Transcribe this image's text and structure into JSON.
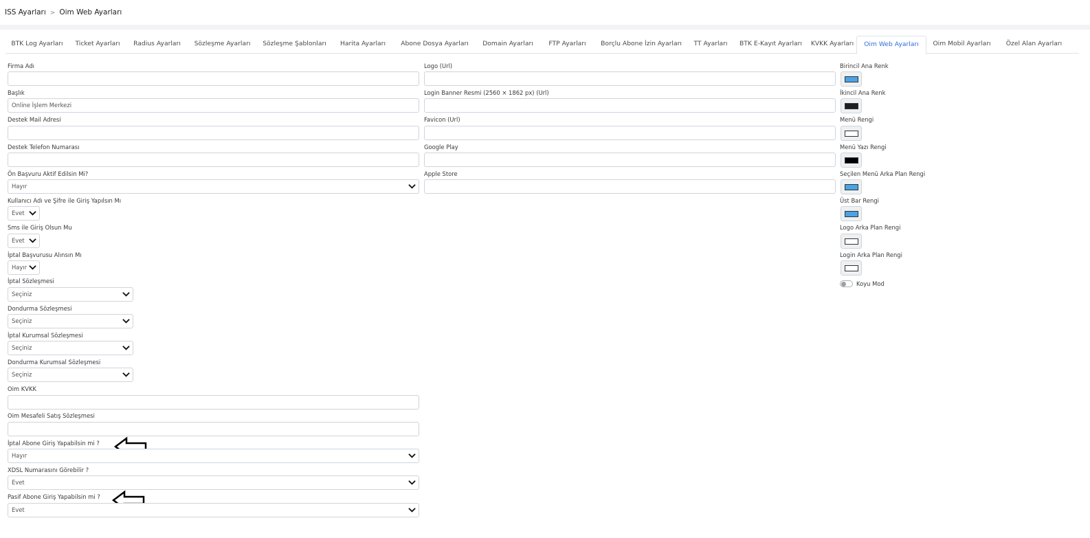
{
  "breadcrumb": {
    "root": "ISS Ayarları",
    "separator": ">",
    "current": "Oim Web Ayarları"
  },
  "tabs": [
    "BTK Log Ayarları",
    "Ticket Ayarları",
    "Radius Ayarları",
    "Sözleşme Ayarları",
    "Sözleşme Şablonları",
    "Harita Ayarları",
    "Abone Dosya Ayarları",
    "Domain Ayarları",
    "FTP Ayarları",
    "Borçlu Abone İzin Ayarları",
    "TT Ayarları",
    "BTK E-Kayıt Ayarları",
    "KVKK Ayarları",
    "Oim Web Ayarları",
    "Oim Mobil Ayarları",
    "Özel Alan Ayarları"
  ],
  "active_tab": "Oim Web Ayarları",
  "left": {
    "firma_adi": {
      "label": "Firma Adı",
      "value": ""
    },
    "baslik": {
      "label": "Başlık",
      "value": "Online İşlem Merkezi"
    },
    "destek_mail": {
      "label": "Destek Mail Adresi",
      "value": ""
    },
    "destek_telefon": {
      "label": "Destek Telefon Numarası",
      "value": ""
    },
    "on_basvuru": {
      "label": "Ön Başvuru Aktif Edilsin Mi?",
      "value": "Hayır"
    },
    "kullanici_sifre": {
      "label": "Kullanıcı Adı ve Şifre ile Giriş Yapılsın Mı",
      "value": "Evet"
    },
    "sms_giris": {
      "label": "Sms ile Giriş Olsun Mu",
      "value": "Evet"
    },
    "iptal_basvurusu": {
      "label": "İptal Başvurusu Alınsın Mı",
      "value": "Hayır"
    },
    "iptal_sozlesmesi": {
      "label": "İptal Sözleşmesi",
      "value": "Seçiniz"
    },
    "dondurma_sozlesmesi": {
      "label": "Dondurma Sözleşmesi",
      "value": "Seçiniz"
    },
    "iptal_kurumsal": {
      "label": "İptal Kurumsal Sözleşmesi",
      "value": "Seçiniz"
    },
    "dondurma_kurumsal": {
      "label": "Dondurma Kurumsal Sözleşmesi",
      "value": "Seçiniz"
    },
    "oim_kvkk": {
      "label": "Oim KVKK",
      "value": ""
    },
    "oim_mesafeli": {
      "label": "Oim Mesafeli Satış Sözleşmesi",
      "value": ""
    },
    "iptal_abone_giris": {
      "label": "İptal Abone Giriş Yapabilsin mi ?",
      "value": "Hayır"
    },
    "xdsl": {
      "label": "XDSL Numarasını Görebilir ?",
      "value": "Evet"
    },
    "pasif_abone_giris": {
      "label": "Pasif Abone Giriş Yapabilsin mi ?",
      "value": "Evet"
    }
  },
  "middle": {
    "logo": {
      "label": "Logo (Url)",
      "value": ""
    },
    "login_banner": {
      "label": "Login Banner Resmi (2560 × 1862 px) (Url)",
      "value": ""
    },
    "favicon": {
      "label": "Favicon (Url)",
      "value": ""
    },
    "google_play": {
      "label": "Google Play",
      "value": ""
    },
    "apple_store": {
      "label": "Apple Store",
      "value": ""
    }
  },
  "colors": [
    {
      "label": "Birincil Ana Renk",
      "color": "#4aa3e6"
    },
    {
      "label": "İkincil Ana Renk",
      "color": "#1f1f1f"
    },
    {
      "label": "Menü Rengi",
      "color": "#ffffff"
    },
    {
      "label": "Menü Yazı Rengi",
      "color": "#000000"
    },
    {
      "label": "Seçilen Menü Arka Plan Rengi",
      "color": "#4aa3e6"
    },
    {
      "label": "Üst Bar Rengi",
      "color": "#4aa3e6"
    },
    {
      "label": "Logo Arka Plan Rengi",
      "color": "#ffffff"
    },
    {
      "label": "Login Arka Plan Rengi",
      "color": "#ffffff"
    }
  ],
  "dark_mode": {
    "label": "Koyu Mod",
    "enabled": false
  }
}
